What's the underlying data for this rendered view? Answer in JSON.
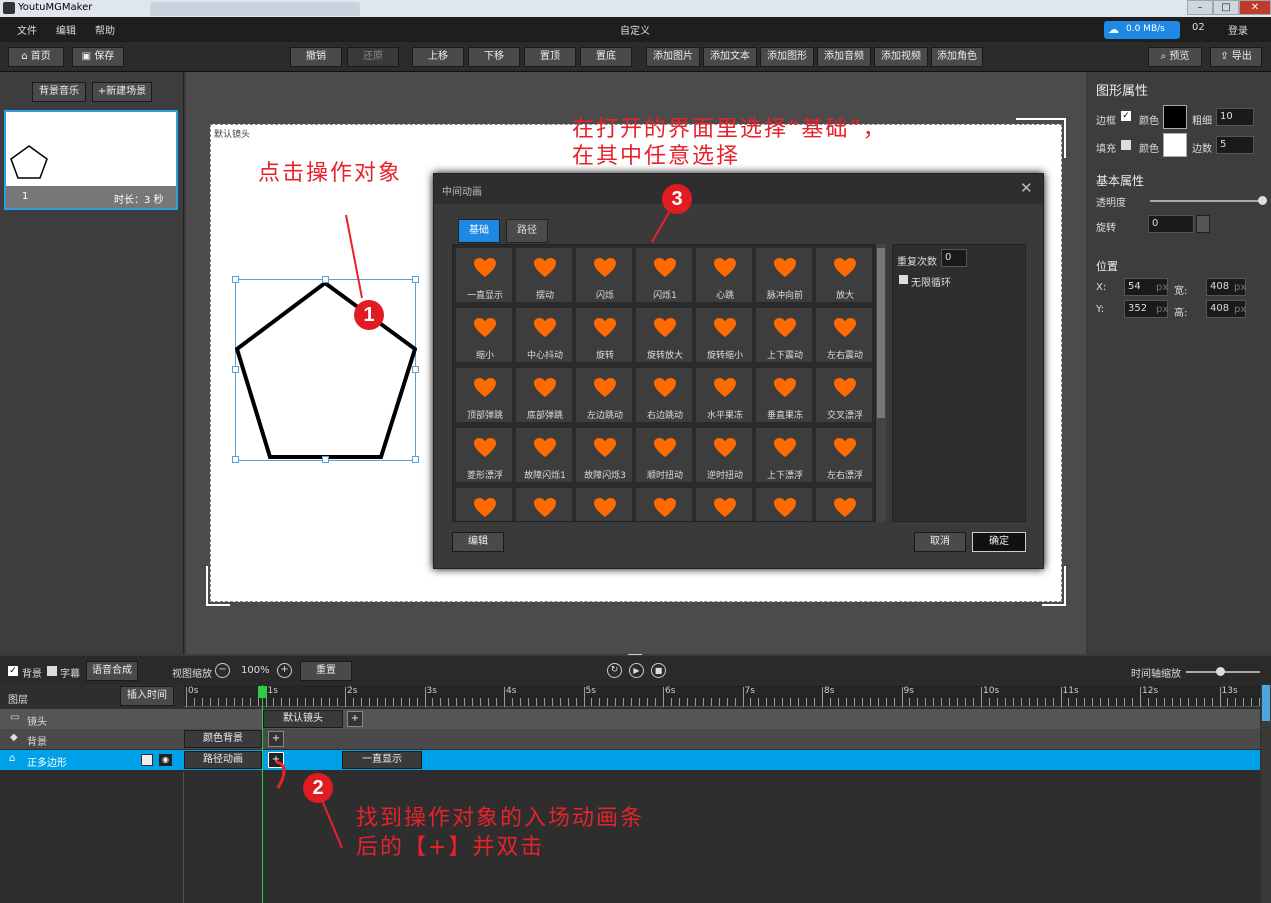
{
  "window": {
    "title": "YoutuMGMaker",
    "min": "–",
    "max": "□",
    "close": "✕"
  },
  "menu": {
    "items": [
      "文件",
      "编辑",
      "帮助"
    ],
    "center_title": "自定义",
    "speed": "0.0 MB/s",
    "num": "02",
    "login": "登录"
  },
  "toolbar": {
    "home": "首页",
    "save": "保存",
    "undo": "撤销",
    "redo": "还原",
    "up": "上移",
    "down": "下移",
    "top": "置顶",
    "bottom": "置底",
    "add_image": "添加图片",
    "add_text": "添加文本",
    "add_shape": "添加图形",
    "add_audio": "添加音频",
    "add_video": "添加视频",
    "add_role": "添加角色",
    "preview": "预览",
    "export": "导出"
  },
  "left": {
    "bg_music": "背景音乐",
    "new_scene": "+新建场景",
    "scene_index": "1",
    "scene_duration": "时长：3 秒"
  },
  "canvas": {
    "default_camera": "默认镜头"
  },
  "right": {
    "shape_title": "图形属性",
    "border": "边框",
    "color": "颜色",
    "thickness": "粗细",
    "thickness_val": "10",
    "fill": "填充",
    "fill_color": "颜色",
    "sides": "边数",
    "sides_val": "5",
    "basic_title": "基本属性",
    "opacity": "透明度",
    "rotation": "旋转",
    "rotation_val": "0",
    "position_title": "位置",
    "x_label": "X:",
    "x_val": "54",
    "w_label": "宽:",
    "w_val": "408",
    "y_label": "Y:",
    "y_val": "352",
    "h_label": "高:",
    "h_val": "408",
    "unit": "px"
  },
  "dialog": {
    "title": "中间动画",
    "close": "✕",
    "tab_basic": "基础",
    "tab_path": "路径",
    "repeat_label": "重复次数",
    "repeat_val": "0",
    "infinite": "无限循环",
    "edit": "编辑",
    "cancel": "取消",
    "ok": "确定",
    "effects": [
      "一直显示",
      "摆动",
      "闪烁",
      "闪烁1",
      "心跳",
      "脉冲向前",
      "放大",
      "缩小",
      "中心抖动",
      "旋转",
      "旋转放大",
      "旋转缩小",
      "上下震动",
      "左右震动",
      "顶部弹跳",
      "底部弹跳",
      "左边跳动",
      "右边跳动",
      "水平果冻",
      "垂直果冻",
      "交叉漂浮",
      "菱形漂浮",
      "故障闪烁1",
      "故障闪烁3",
      "顺时扭动",
      "逆时扭动",
      "上下漂浮",
      "左右漂浮",
      "",
      "",
      "",
      "",
      "",
      "",
      ""
    ]
  },
  "timeline": {
    "bg_check": "背景",
    "subtitle_check": "字幕",
    "voice": "语音合成",
    "zoom_label": "视图缩放",
    "zoom_val": "100%",
    "reset": "重置",
    "axis_zoom": "时间轴缩放",
    "layers": "图层",
    "insert_time": "插入时间",
    "ticks": [
      "0s",
      "1s",
      "2s",
      "3s",
      "4s",
      "5s",
      "6s",
      "7s",
      "8s",
      "9s",
      "10s",
      "11s",
      "12s",
      "13s"
    ],
    "rows": [
      {
        "name": "镜头",
        "block": "默认镜头"
      },
      {
        "name": "背景",
        "block": "颜色背景"
      },
      {
        "name": "正多边形",
        "block": "路径动画",
        "block2": "一直显示"
      }
    ],
    "plus": "+"
  },
  "annotations": {
    "a1": "点击操作对象",
    "a3_line1": "在打开的界面里选择“基础”，",
    "a3_line2": "在其中任意选择",
    "a2_line1": "找到操作对象的入场动画条",
    "a2_line2": "后的【+】并双击",
    "n1": "1",
    "n2": "2",
    "n3": "3"
  },
  "colors": {
    "accent": "#00a0e9",
    "annotation": "#e8222a",
    "orange": "#ff6a00"
  }
}
